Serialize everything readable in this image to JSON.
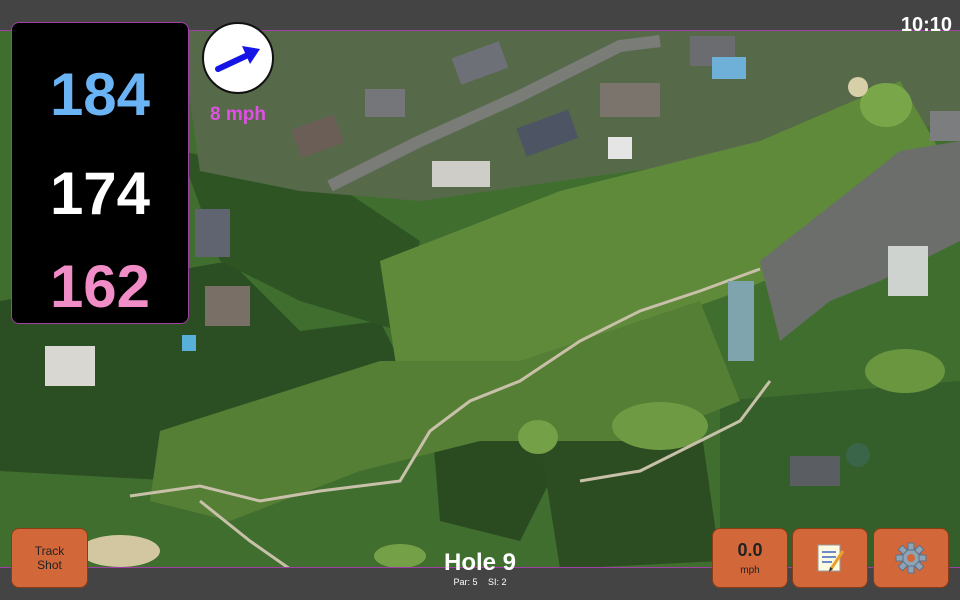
{
  "status": {
    "time": "10:10"
  },
  "distances": {
    "back": "184",
    "middle": "174",
    "front": "162"
  },
  "wind": {
    "speed": "8 mph",
    "icon": "wind-arrow-icon"
  },
  "buttons": {
    "track_shot_line1": "Track",
    "track_shot_line2": "Shot",
    "speed_value": "0.0",
    "speed_unit": "mph",
    "notes_icon": "notepad-icon",
    "settings_icon": "gear-icon"
  },
  "hole": {
    "title": "Hole 9",
    "par": "Par: 5",
    "si": "SI: 2"
  },
  "colors": {
    "back": "#6ab4f5",
    "middle": "#ffffff",
    "front": "#f08cc6",
    "accent": "#a03fa6",
    "button": "#d2683a",
    "wind_text": "#e14fe5"
  }
}
